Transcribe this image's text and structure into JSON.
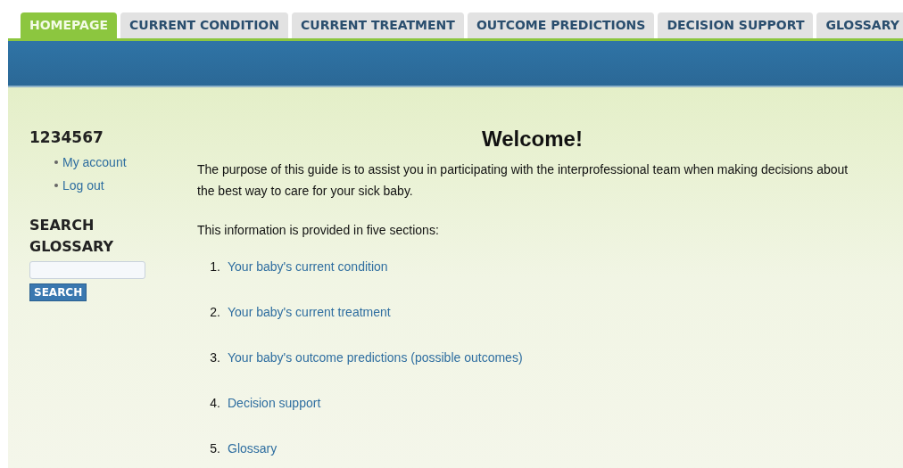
{
  "tabs": [
    {
      "label": "HOMEPAGE",
      "selected": true
    },
    {
      "label": "CURRENT CONDITION",
      "selected": false
    },
    {
      "label": "CURRENT TREATMENT",
      "selected": false
    },
    {
      "label": "OUTCOME PREDICTIONS",
      "selected": false
    },
    {
      "label": "DECISION SUPPORT",
      "selected": false
    },
    {
      "label": "GLOSSARY",
      "selected": false
    }
  ],
  "sidebar": {
    "user_id": "1234567",
    "links": [
      "My account",
      "Log out"
    ],
    "search_title": "SEARCH GLOSSARY",
    "search_button": "SEARCH"
  },
  "main": {
    "title": "Welcome!",
    "intro": "The purpose of this guide is to assist you in participating with the interprofessional team when making decisions about the best way to care for your sick baby.",
    "sections_lead": "This information is provided in five sections:",
    "sections": [
      {
        "number": "1.",
        "label": "Your baby's current condition"
      },
      {
        "number": "2.",
        "label": "Your baby's current treatment"
      },
      {
        "number": "3.",
        "label": "Your baby's outcome predictions (possible outcomes)"
      },
      {
        "number": "4.",
        "label": "Decision support"
      },
      {
        "number": "5.",
        "label": "Glossary"
      }
    ]
  }
}
